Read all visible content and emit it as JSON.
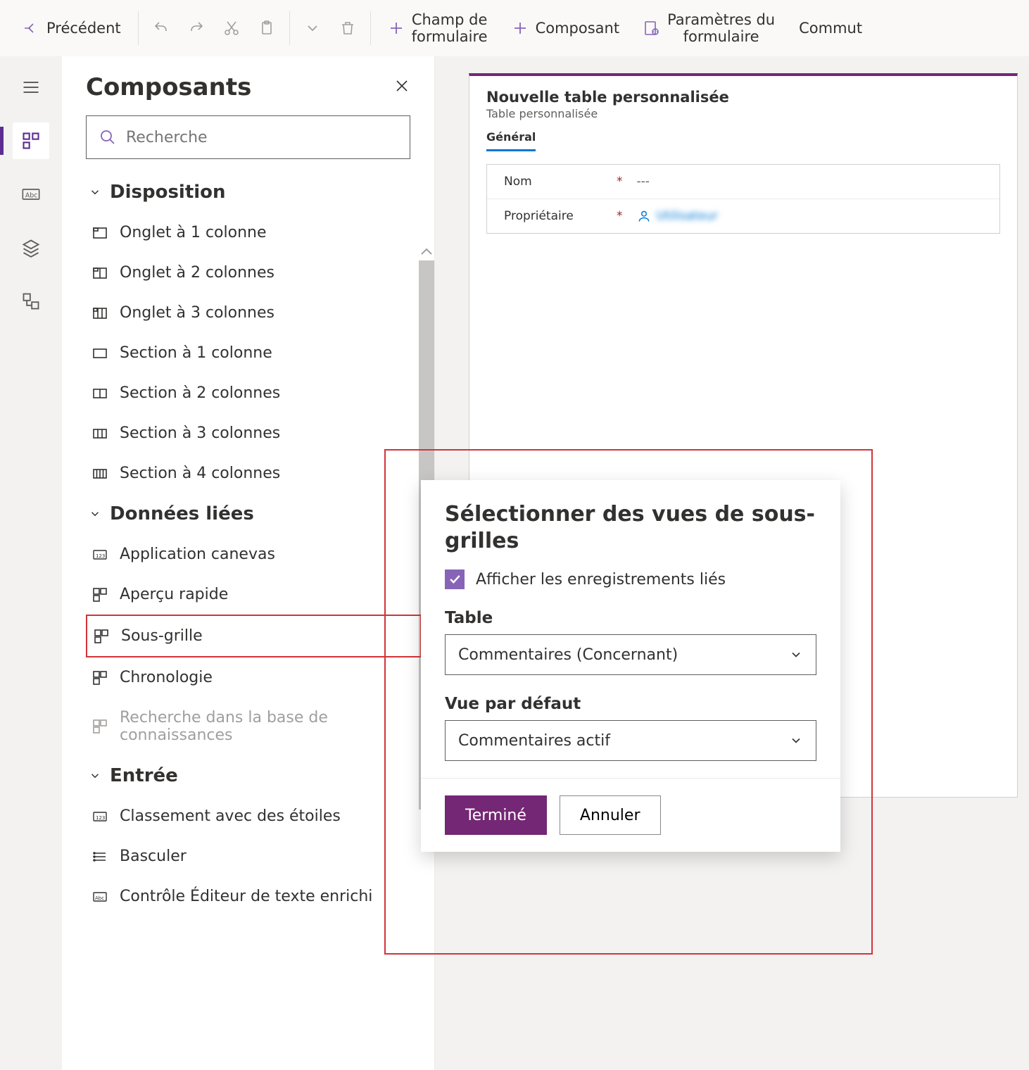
{
  "toolbar": {
    "back": "Précédent",
    "form_field": "Champ de\nformulaire",
    "component": "Composant",
    "form_settings": "Paramètres du\nformulaire",
    "switch": "Commut"
  },
  "panel": {
    "title": "Composants",
    "search_placeholder": "Recherche"
  },
  "groups": {
    "layout": {
      "title": "Disposition",
      "items": [
        "Onglet à 1 colonne",
        "Onglet à 2 colonnes",
        "Onglet à 3 colonnes",
        "Section à 1 colonne",
        "Section à 2 colonnes",
        "Section à 3 colonnes",
        "Section à 4 colonnes"
      ]
    },
    "related": {
      "title": "Données liées",
      "items": [
        "Application canevas",
        "Aperçu rapide",
        "Sous-grille",
        "Chronologie",
        "Recherche dans la base de connaissances"
      ]
    },
    "input": {
      "title": "Entrée",
      "items": [
        "Classement avec des étoiles",
        "Basculer",
        "Contrôle Éditeur de texte enrichi"
      ]
    }
  },
  "form": {
    "title": "Nouvelle table personnalisée",
    "subtitle": "Table personnalisée",
    "tab": "Général",
    "field_name_label": "Nom",
    "field_name_value": "---",
    "field_owner_label": "Propriétaire",
    "field_owner_value": "Utilisateur"
  },
  "popover": {
    "title": "Sélectionner des vues de sous-grilles",
    "checkbox_label": "Afficher les enregistrements liés",
    "table_label": "Table",
    "table_value": "Commentaires (Concernant)",
    "view_label": "Vue par défaut",
    "view_value": "Commentaires actif",
    "done": "Terminé",
    "cancel": "Annuler"
  }
}
